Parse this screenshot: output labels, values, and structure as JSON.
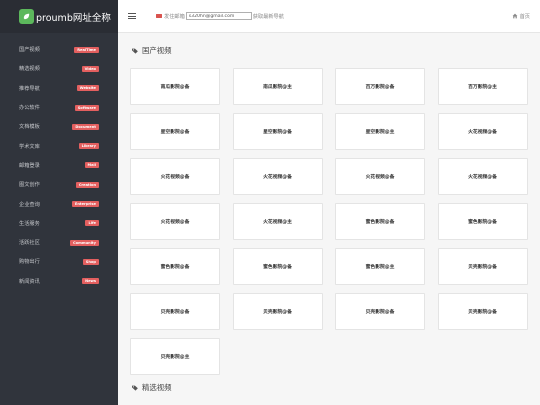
{
  "app": {
    "logo_text": "proumb网址全称"
  },
  "sidebar": {
    "items": [
      {
        "label": "国产视频",
        "badge": "RealTime"
      },
      {
        "label": "精选视频",
        "badge": "Video"
      },
      {
        "label": "推荐导航",
        "badge": "Website"
      },
      {
        "label": "办公软件",
        "badge": "Software"
      },
      {
        "label": "文档模板",
        "badge": "Document"
      },
      {
        "label": "学术文库",
        "badge": "Library"
      },
      {
        "label": "邮箱登录",
        "badge": "Mail"
      },
      {
        "label": "图文创作",
        "badge": "Creation"
      },
      {
        "label": "企业查询",
        "badge": "Enterprise"
      },
      {
        "label": "生活服务",
        "badge": "Life"
      },
      {
        "label": "活跃社区",
        "badge": "Community"
      },
      {
        "label": "购物出行",
        "badge": "Shop"
      },
      {
        "label": "新闻资讯",
        "badge": "News"
      }
    ]
  },
  "topbar": {
    "mail_prefix": "发住邮箱",
    "mail_value": "s320hn@gmail.com",
    "mail_suffix": "获取最新导航",
    "home_label": "首页"
  },
  "sections": [
    {
      "title": "国产视频",
      "cards": [
        "南瓜影院@备",
        "南瓜影院@主",
        "百万影院@备",
        "百万影院@主",
        "星空影院@备",
        "星空影院@备",
        "星空影院@主",
        "火花视频@备",
        "火花视频@备",
        "火花视频@备",
        "火花视频@备",
        "火花视频@备",
        "火花视频@备",
        "火花视频@主",
        "蜜色影院@备",
        "蜜色影院@备",
        "蜜色影院@备",
        "蜜色影院@备",
        "蜜色影院@主",
        "贝壳影院@备",
        "贝壳影院@备",
        "贝壳影院@备",
        "贝壳影院@备",
        "贝壳影院@备",
        "贝壳影院@主"
      ]
    },
    {
      "title": "精选视频",
      "cards": []
    }
  ],
  "colors": {
    "sidebar_bg": "#30343c",
    "badge": "#e35f5f",
    "logo_icon": "#5cb85c",
    "mail_icon": "#d9534f"
  }
}
